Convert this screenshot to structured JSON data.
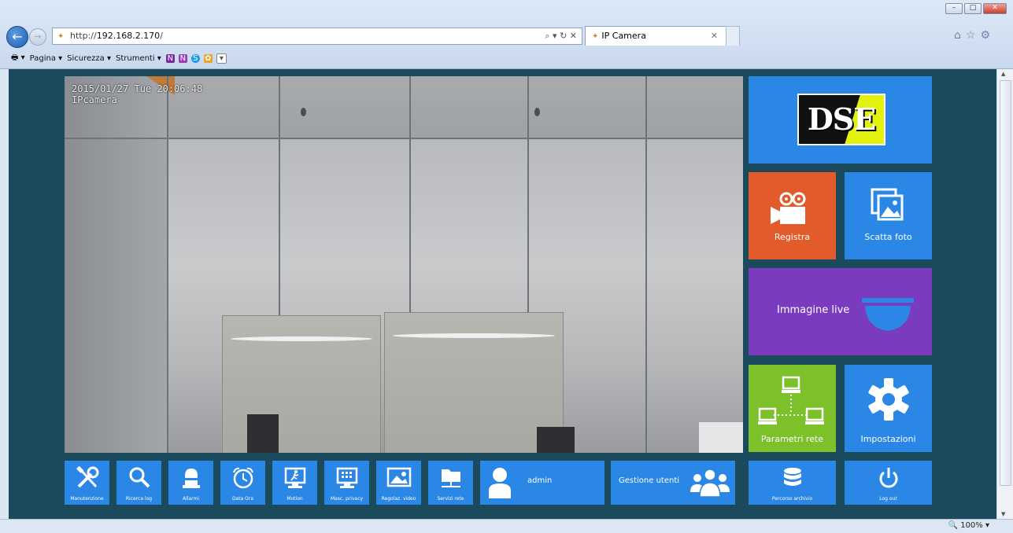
{
  "browser": {
    "url_prefix": "http://",
    "url_host": "192.168.2.170",
    "url_suffix": "/",
    "url_controls": "⌕ ▾ ↻ ✕",
    "tab_title": "IP Camera",
    "menu": [
      "Pagina ▾",
      "Sicurezza ▾",
      "Strumenti ▾"
    ],
    "zoom": "100%"
  },
  "video": {
    "timestamp": "2015/01/27 Tue 20:06:48",
    "camera_name": "IPcamera"
  },
  "tiles": {
    "logo": "DSE",
    "record": "Registra",
    "snapshot": "Scatta foto",
    "live": "Immagine live",
    "network": "Parametri rete",
    "settings": "Impostazioni",
    "archive": "Percorso archivio",
    "logout": "Log out",
    "user": "admin",
    "user_mgmt": "Gestione utenti"
  },
  "bottom_tiles": [
    {
      "label": "Manutenzione",
      "icon": "tools-icon"
    },
    {
      "label": "Ricerca log",
      "icon": "magnifier-icon"
    },
    {
      "label": "Allarmi",
      "icon": "alarm-bell-icon"
    },
    {
      "label": "Data Ora",
      "icon": "clock-icon"
    },
    {
      "label": "Motion",
      "icon": "motion-detect-icon"
    },
    {
      "label": "Masc. privacy",
      "icon": "privacy-mask-icon"
    },
    {
      "label": "Regolaz. video",
      "icon": "image-adjust-icon"
    },
    {
      "label": "Servizi rete",
      "icon": "network-folder-icon"
    }
  ],
  "colors": {
    "page_bg": "#1a4a5c",
    "tile_blue": "#2a87e5",
    "tile_orange": "#e35a2b",
    "tile_purple": "#7a3bbf",
    "tile_green": "#7cc12a"
  }
}
